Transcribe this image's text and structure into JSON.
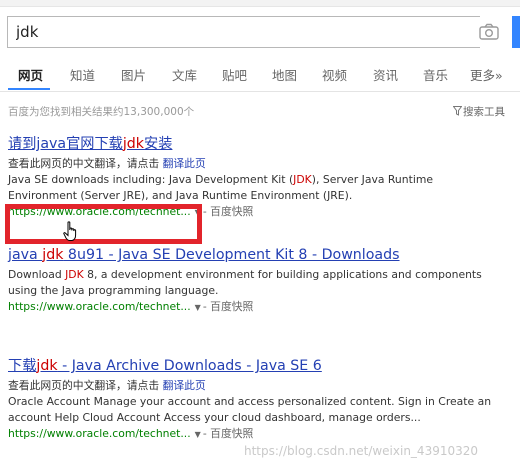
{
  "search": {
    "value": "jdk",
    "camera_icon": "camera-icon"
  },
  "tabs": [
    {
      "label": "网页",
      "active": true
    },
    {
      "label": "知道"
    },
    {
      "label": "图片"
    },
    {
      "label": "文库"
    },
    {
      "label": "贴吧"
    },
    {
      "label": "地图"
    },
    {
      "label": "视频"
    },
    {
      "label": "资讯"
    },
    {
      "label": "音乐"
    },
    {
      "label": "更多»"
    }
  ],
  "result_count": "百度为您找到相关结果约13,300,000个",
  "tools_label": "搜索工具",
  "results": [
    {
      "title_pre": "请到java官网下载",
      "title_hl": "jdk",
      "title_post": "安装",
      "translate_text": "查看此网页的中文翻译，请点击",
      "translate_link": "翻译此页",
      "desc1_pre": "Java SE downloads including: Java Development Kit (",
      "desc1_hl": "JDK",
      "desc1_post": "), Server Java Runtime",
      "desc2": "Environment (Server JRE), and Java Runtime Environment (JRE).",
      "url": "https://www.oracle.com/technet...",
      "snapshot": "百度快照"
    },
    {
      "title_pre": "java ",
      "title_hl": "jdk",
      "title_post": " 8u91 - Java SE Development Kit 8 - Downloads",
      "desc1_pre": "Download ",
      "desc1_hl": "JDK",
      "desc1_post": " 8, a development environment for building applications and components",
      "desc2": "using the Java programming language.",
      "url": "https://www.oracle.com/technet...",
      "snapshot": "百度快照"
    },
    {
      "title_pre": "下载",
      "title_hl": "jdk",
      "title_post": " - Java Archive Downloads - Java SE 6",
      "translate_text": "查看此网页的中文翻译，请点击",
      "translate_link": "翻译此页",
      "desc1": "Oracle Account Manage your account and access personalized content. Sign in Create an",
      "desc2": "account Help Cloud Account Access your cloud dashboard, manage orders...",
      "url": "https://www.oracle.com/technet...",
      "snapshot": "百度快照"
    }
  ],
  "watermark": "https://blog.csdn.net/weixin_43910320",
  "colors": {
    "accent": "#3385ff",
    "link": "#2440b3",
    "keyword": "#cc0000",
    "url": "#008000",
    "annotation": "#e2242b"
  }
}
